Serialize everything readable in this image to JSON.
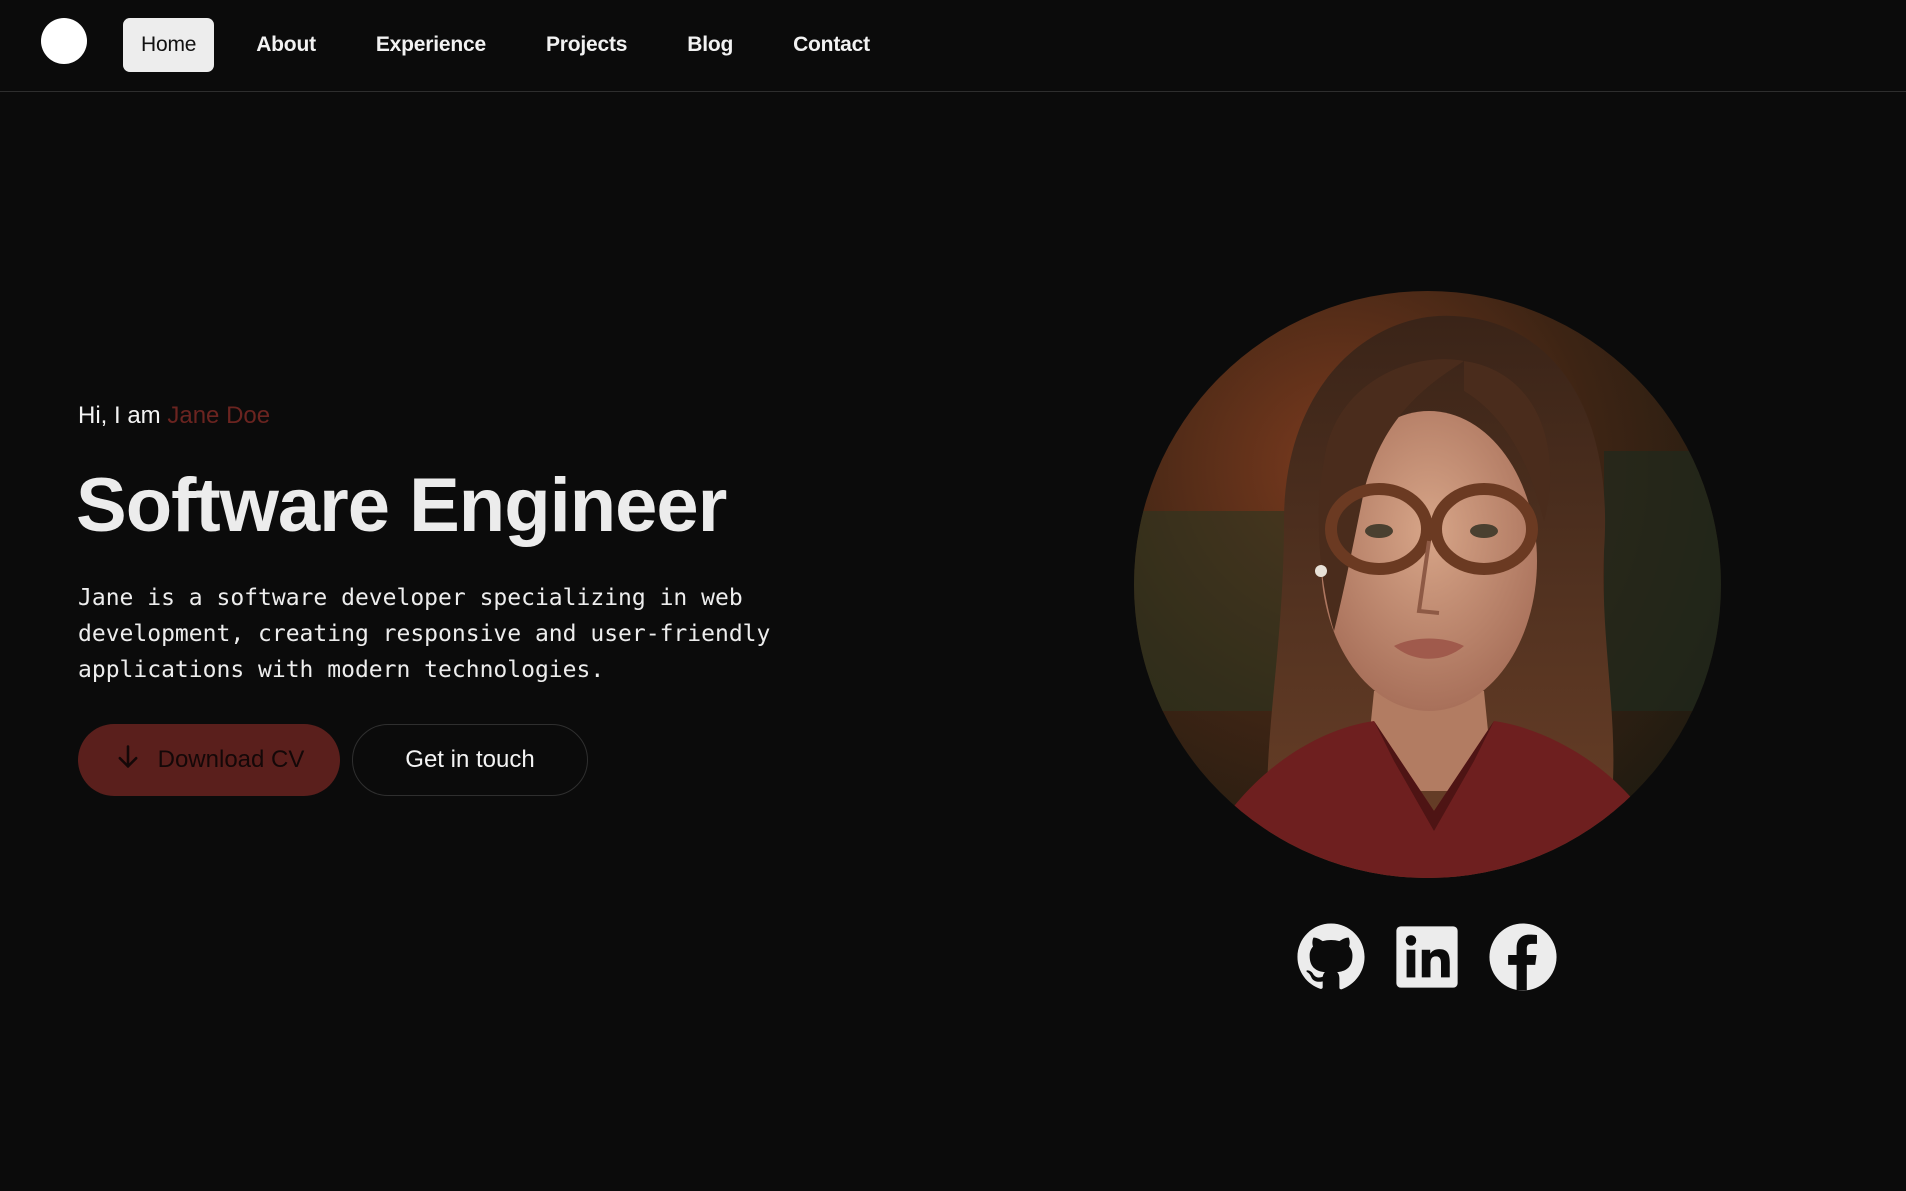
{
  "nav": {
    "items": [
      {
        "label": "Home",
        "active": true
      },
      {
        "label": "About"
      },
      {
        "label": "Experience"
      },
      {
        "label": "Projects"
      },
      {
        "label": "Blog"
      },
      {
        "label": "Contact"
      }
    ]
  },
  "hero": {
    "greeting_prefix": "Hi, I am",
    "name": "Jane Doe",
    "title": "Software Engineer",
    "description": "Jane is a software developer specializing in web development, creating responsive and user-friendly applications with modern technologies.",
    "primary_button": "Download CV",
    "secondary_button": "Get in touch"
  },
  "social": {
    "items": [
      {
        "icon": "github-icon"
      },
      {
        "icon": "linkedin-icon"
      },
      {
        "icon": "facebook-icon"
      }
    ]
  },
  "colors": {
    "background": "#0b0b0b",
    "accent": "#5a1f1c",
    "name_accent": "#6b2420",
    "text": "#ececec"
  }
}
